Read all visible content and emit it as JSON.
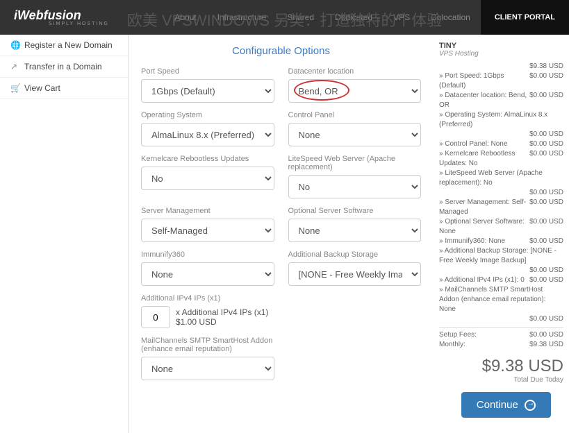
{
  "overlay": "欧美 VPSWINDOWS 另类：打造独特的个体验",
  "logo": {
    "main": "iWebfusion",
    "sub": "SIMPLY HOSTING"
  },
  "nav": {
    "about": "About",
    "infrastructure": "Infrastructure",
    "shared": "Shared",
    "dedicated": "Dedicated",
    "vps": "VPS",
    "colocation": "Colocation"
  },
  "client_portal": "CLIENT PORTAL",
  "sidebar": {
    "register": "Register a New Domain",
    "transfer": "Transfer in a Domain",
    "cart": "View Cart"
  },
  "section_title": "Configurable Options",
  "options": {
    "port_speed": {
      "label": "Port Speed",
      "value": "1Gbps (Default)"
    },
    "datacenter": {
      "label": "Datacenter location",
      "value": "Bend, OR"
    },
    "os": {
      "label": "Operating System",
      "value": "AlmaLinux 8.x (Preferred)"
    },
    "control_panel": {
      "label": "Control Panel",
      "value": "None"
    },
    "kernelcare": {
      "label": "Kernelcare Rebootless Updates",
      "value": "No"
    },
    "litespeed": {
      "label": "LiteSpeed Web Server (Apache replacement)",
      "value": "No"
    },
    "server_mgmt": {
      "label": "Server Management",
      "value": "Self-Managed"
    },
    "opt_software": {
      "label": "Optional Server Software",
      "value": "None"
    },
    "immunify": {
      "label": "Immunify360",
      "value": "None"
    },
    "backup": {
      "label": "Additional Backup Storage",
      "value": "[NONE - Free Weekly Image"
    },
    "ipv4": {
      "label": "Additional IPv4 IPs (x1)",
      "qty": "0",
      "suffix": "x Additional IPv4 IPs (x1) $1.00 USD"
    },
    "mailchannels": {
      "label": "MailChannels SMTP SmartHost Addon (enhance email reputation)",
      "value": "None"
    }
  },
  "summary": {
    "title": "TINY",
    "sub": "VPS Hosting",
    "base_price": "$9.38 USD",
    "lines": [
      {
        "label": "» Port Speed: 1Gbps (Default)",
        "price": "$0.00 USD"
      },
      {
        "label": "» Datacenter location: Bend, OR",
        "price": "$0.00 USD"
      },
      {
        "label": "» Operating System: AlmaLinux 8.x (Preferred)",
        "price": ""
      },
      {
        "label": "",
        "price": "$0.00 USD"
      },
      {
        "label": "» Control Panel: None",
        "price": "$0.00 USD"
      },
      {
        "label": "» Kernelcare Rebootless Updates: No",
        "price": "$0.00 USD"
      },
      {
        "label": "» LiteSpeed Web Server (Apache replacement): No",
        "price": ""
      },
      {
        "label": "",
        "price": "$0.00 USD"
      },
      {
        "label": "» Server Management: Self-Managed",
        "price": "$0.00 USD"
      },
      {
        "label": "» Optional Server Software: None",
        "price": "$0.00 USD"
      },
      {
        "label": "» Immunify360: None",
        "price": "$0.00 USD"
      },
      {
        "label": "» Additional Backup Storage: [NONE - Free Weekly Image Backup]",
        "price": ""
      },
      {
        "label": "",
        "price": "$0.00 USD"
      },
      {
        "label": "» Additional IPv4 IPs (x1): 0",
        "price": "$0.00 USD"
      },
      {
        "label": "» MailChannels SMTP SmartHost Addon (enhance email reputation): None",
        "price": ""
      },
      {
        "label": "",
        "price": "$0.00 USD"
      }
    ],
    "setup_label": "Setup Fees:",
    "setup_price": "$0.00 USD",
    "monthly_label": "Monthly:",
    "monthly_price": "$9.38 USD",
    "total": "$9.38 USD",
    "total_label": "Total Due Today"
  },
  "continue": "Continue"
}
